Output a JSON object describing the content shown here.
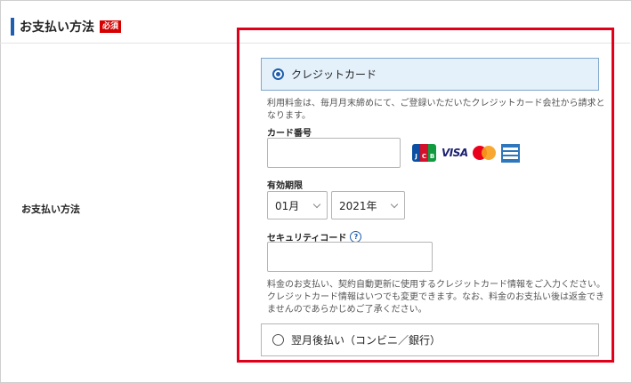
{
  "section": {
    "title": "お支払い方法",
    "required_badge": "必須"
  },
  "row_label": "お支払い方法",
  "credit_option": {
    "label": "クレジットカード",
    "selected": true,
    "note": "利用料金は、毎月月末締めにて、ご登録いただいたクレジットカード会社から請求となります。"
  },
  "card_number": {
    "label": "カード番号",
    "value": ""
  },
  "card_brands": [
    "jcb-logo",
    "visa-logo",
    "mastercard-logo",
    "amex-logo"
  ],
  "card_brand_text": {
    "jcb": [
      "J",
      "C",
      "B"
    ],
    "visa": "VISA"
  },
  "expiry": {
    "label": "有効期限",
    "month": "01月",
    "year": "2021年"
  },
  "security_code": {
    "label": "セキュリティコード",
    "help_icon": "?",
    "value": ""
  },
  "payment_note": "料金のお支払い、契約自動更新に使用するクレジットカード情報をご入力ください。クレジットカード情報はいつでも変更できます。なお、料金のお支払い後は返金できませんのであらかじめご了承ください。",
  "later_option": {
    "label": "翌月後払い（コンビニ／銀行）",
    "selected": false
  },
  "colors": {
    "accent": "#1f5fae",
    "highlight_border": "#e1001a",
    "required_badge": "#d60000",
    "selected_bg": "#e4f1fb"
  }
}
